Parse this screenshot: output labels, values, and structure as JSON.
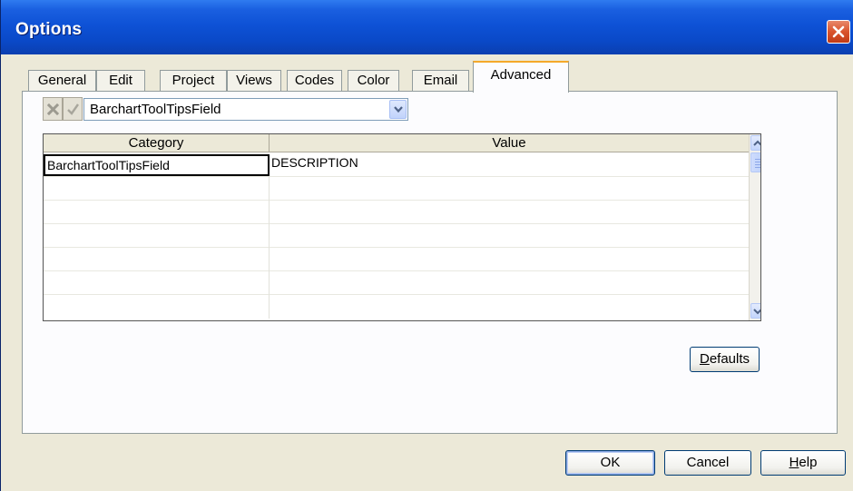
{
  "window": {
    "title": "Options"
  },
  "tabs": [
    {
      "label": "General",
      "active": false
    },
    {
      "label": "Edit",
      "active": false
    },
    {
      "label": "Project",
      "active": false
    },
    {
      "label": "Views",
      "active": false
    },
    {
      "label": "Codes",
      "active": false
    },
    {
      "label": "Color",
      "active": false
    },
    {
      "label": "Email",
      "active": false
    },
    {
      "label": "Advanced",
      "active": true
    }
  ],
  "advanced": {
    "field_select": {
      "value": "BarchartToolTipsField"
    },
    "grid": {
      "columns": [
        "Category",
        "Value"
      ],
      "rows": [
        {
          "category": "BarchartToolTipsField",
          "value": "DESCRIPTION"
        },
        {
          "category": "",
          "value": ""
        },
        {
          "category": "",
          "value": ""
        },
        {
          "category": "",
          "value": ""
        },
        {
          "category": "",
          "value": ""
        },
        {
          "category": "",
          "value": ""
        },
        {
          "category": "",
          "value": ""
        }
      ]
    },
    "defaults_button": {
      "label_prefix": "",
      "label_mnemonic": "D",
      "label_rest": "efaults"
    }
  },
  "footer": {
    "ok_label": "OK",
    "cancel_label": "Cancel",
    "help_mnemonic": "H",
    "help_rest": "elp"
  },
  "icons": {
    "close": "close-icon",
    "cancel_edit": "x-icon",
    "apply_edit": "checkmark-icon",
    "dropdown": "chevron-down-icon",
    "scroll_up": "chevron-up-icon",
    "scroll_down": "chevron-down-icon"
  },
  "colors": {
    "titlebar": "#0a49c8",
    "tab_active_accent": "#f5a92a",
    "dialog_bg": "#ece9d8",
    "close_button": "#d9542d"
  }
}
